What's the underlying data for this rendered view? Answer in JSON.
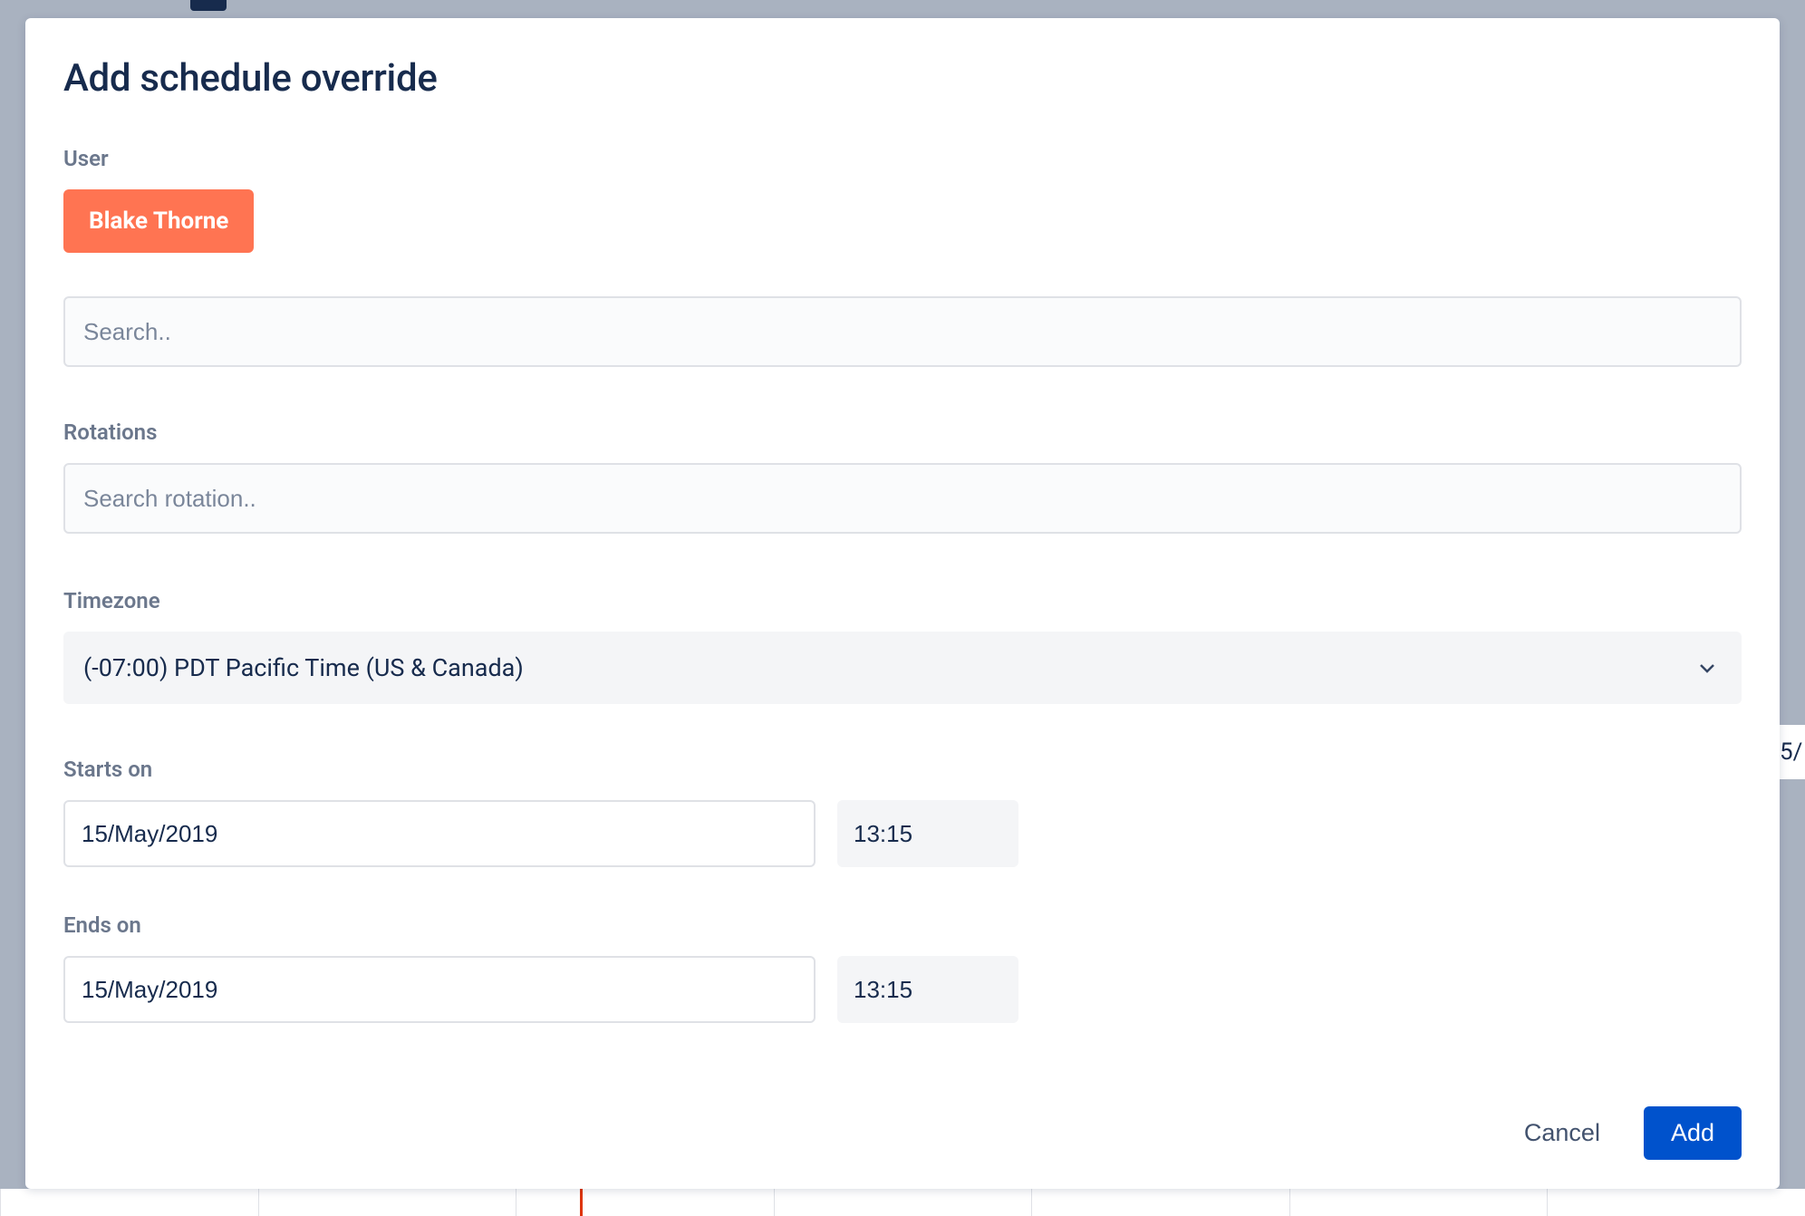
{
  "modal": {
    "title": "Add schedule override",
    "user": {
      "label": "User",
      "chip": "Blake Thorne",
      "search_placeholder": "Search.."
    },
    "rotations": {
      "label": "Rotations",
      "search_placeholder": "Search rotation.."
    },
    "timezone": {
      "label": "Timezone",
      "value": "(-07:00) PDT Pacific Time (US & Canada)"
    },
    "starts": {
      "label": "Starts on",
      "date": "15/May/2019",
      "time": "13:15"
    },
    "ends": {
      "label": "Ends on",
      "date": "15/May/2019",
      "time": "13:15"
    },
    "footer": {
      "cancel": "Cancel",
      "add": "Add"
    }
  },
  "background": {
    "right_hint": "5/"
  }
}
